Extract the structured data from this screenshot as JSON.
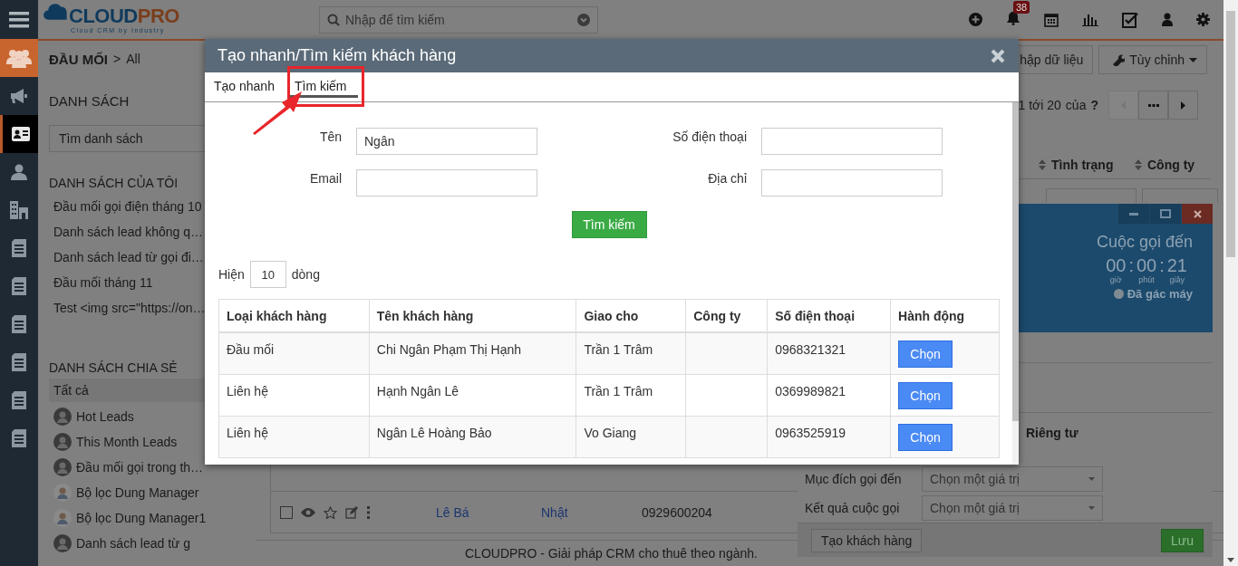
{
  "nav_rail": {
    "items": [
      {
        "kind": "people",
        "selected": true,
        "highlighted": false
      },
      {
        "kind": "megaphone",
        "selected": false,
        "highlighted": false
      },
      {
        "kind": "card",
        "selected": false,
        "highlighted": true
      },
      {
        "kind": "person",
        "selected": false,
        "highlighted": false
      },
      {
        "kind": "building",
        "selected": false,
        "highlighted": false
      },
      {
        "kind": "document",
        "selected": false,
        "highlighted": false
      },
      {
        "kind": "document",
        "selected": false,
        "highlighted": false
      },
      {
        "kind": "document",
        "selected": false,
        "highlighted": false
      },
      {
        "kind": "document",
        "selected": false,
        "highlighted": false
      },
      {
        "kind": "document",
        "selected": false,
        "highlighted": false
      },
      {
        "kind": "document",
        "selected": false,
        "highlighted": false
      }
    ]
  },
  "header": {
    "logo": {
      "brand_1": "CLOUD",
      "brand_2": "PRO",
      "tagline": "Cloud CRM by Industry"
    },
    "search": {
      "placeholder": "Nhập để tìm kiếm"
    },
    "notification_count": "38"
  },
  "list_panel": {
    "breadcrumb": {
      "module": "ĐẦU MỐI",
      "separator": ">",
      "current": "All"
    },
    "title": "DANH SÁCH",
    "search": {
      "placeholder": "Tìm danh sách"
    },
    "my_lists": {
      "title": "DANH SÁCH CỦA TÔI",
      "items": [
        {
          "label": "Đầu mối gọi điện tháng 10"
        },
        {
          "label": "Danh sách lead không q…"
        },
        {
          "label": "Danh sách lead từ gọi đi…"
        },
        {
          "label": "Đầu mối tháng 11"
        },
        {
          "label": "Test <img src=\"https://on…"
        }
      ]
    },
    "shared_lists": {
      "title": "DANH SÁCH CHIA SẺ",
      "items": [
        {
          "label": "Tất cả",
          "kind": "plain",
          "selected": true
        },
        {
          "label": "Hot Leads",
          "kind": "photo",
          "selected": false
        },
        {
          "label": "This Month Leads",
          "kind": "photo",
          "selected": false
        },
        {
          "label": "Đầu mối gọi trong th…",
          "kind": "photo",
          "selected": false
        },
        {
          "label": "Bộ lọc Dung Manager",
          "kind": "figure",
          "selected": false
        },
        {
          "label": "Bộ lọc Dung Manager1",
          "kind": "figure",
          "selected": false
        },
        {
          "label": "Danh sách lead từ g",
          "kind": "photo",
          "selected": false
        }
      ]
    }
  },
  "main": {
    "toolbar": {
      "buttons": [
        {
          "label": "hập dữ liệu",
          "kind": "plain"
        },
        {
          "label": "Tùy chỉnh",
          "kind": "menu"
        }
      ]
    },
    "pager": {
      "range": "1 tới 20",
      "of": "của",
      "total": "?",
      "prev_disabled": true
    },
    "columns": [
      "Tình trạng",
      "Công ty"
    ],
    "rows": [
      {
        "name": "Lê Bá",
        "assignee": "Nhật",
        "phone": "0929600204",
        "checked": false
      }
    ],
    "footer": "CLOUDPRO - Giải pháp CRM cho thuê theo ngành."
  },
  "call_panel": {
    "title": "Cuộc gọi đến",
    "timer": {
      "parts": [
        {
          "value": "00",
          "unit": "giờ"
        },
        {
          "value": "00",
          "unit": "phút"
        },
        {
          "value": "21",
          "unit": "giây"
        }
      ],
      "separators": [
        ":",
        ":"
      ]
    },
    "status": "Đã gác máy",
    "privacy_label": "Riêng tư",
    "fields": [
      {
        "label": "Mục đích gọi đến",
        "placeholder": "Chọn một giá trị"
      },
      {
        "label": "Kết quả cuộc gọi",
        "placeholder": "Chọn một giá trị"
      }
    ],
    "buttons": [
      {
        "label": "Tạo khách hàng",
        "kind": "secondary"
      },
      {
        "label": "Lưu",
        "kind": "primary"
      }
    ]
  },
  "modal": {
    "title": "Tạo nhanh/Tìm kiếm khách hàng",
    "tabs": [
      {
        "label": "Tạo nhanh",
        "selected": false,
        "highlighted": false
      },
      {
        "label": "Tìm kiếm",
        "selected": true,
        "highlighted": true
      }
    ],
    "form": {
      "fields": [
        {
          "label": "Tên",
          "value": "Ngân"
        },
        {
          "label": "Số điện thoại"
        },
        {
          "label": "Email"
        },
        {
          "label": "Địa chỉ"
        }
      ],
      "search_button": "Tìm kiếm"
    },
    "page_size": {
      "prefix": "Hiện",
      "value": "10",
      "suffix": "dòng"
    },
    "table": {
      "columns": [
        "Loại khách hàng",
        "Tên khách hàng",
        "Giao cho",
        "Công ty",
        "Số điện thoại",
        "Hành động"
      ],
      "rows": [
        {
          "type": "Đầu mối",
          "name": "Chi Ngân Phạm Thị Hạnh",
          "assignee": "Trần 1 Trâm",
          "phone": "0968321321",
          "action": "Chọn"
        },
        {
          "type": "Liên hệ",
          "name": "Hạnh Ngân Lê",
          "assignee": "Trần 1 Trâm",
          "phone": "0369989821",
          "action": "Chọn"
        },
        {
          "type": "Liên hệ",
          "name": "Ngân Lê Hoàng Bảo",
          "assignee": "Vo Giang",
          "phone": "0963525919",
          "action": "Chọn"
        }
      ]
    }
  }
}
